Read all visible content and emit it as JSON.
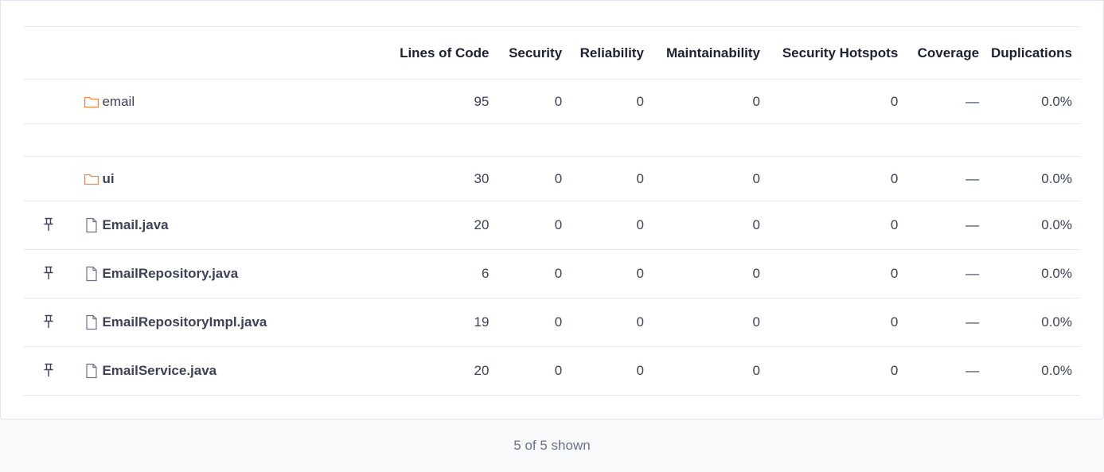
{
  "columns": {
    "loc": "Lines of Code",
    "security": "Security",
    "reliability": "Reliability",
    "maintainability": "Maintainability",
    "hotspots": "Security Hotspots",
    "coverage": "Coverage",
    "duplications": "Duplications"
  },
  "rows": [
    {
      "kind": "folder",
      "name": "email",
      "loc": "95",
      "security": "0",
      "reliability": "0",
      "maintainability": "0",
      "hotspots": "0",
      "coverage": "—",
      "duplications": "0.0%"
    },
    {
      "kind": "folder",
      "name": "ui",
      "loc": "30",
      "security": "0",
      "reliability": "0",
      "maintainability": "0",
      "hotspots": "0",
      "coverage": "—",
      "duplications": "0.0%"
    },
    {
      "kind": "file",
      "name": "Email.java",
      "loc": "20",
      "security": "0",
      "reliability": "0",
      "maintainability": "0",
      "hotspots": "0",
      "coverage": "—",
      "duplications": "0.0%"
    },
    {
      "kind": "file",
      "name": "EmailRepository.java",
      "loc": "6",
      "security": "0",
      "reliability": "0",
      "maintainability": "0",
      "hotspots": "0",
      "coverage": "—",
      "duplications": "0.0%"
    },
    {
      "kind": "file",
      "name": "EmailRepositoryImpl.java",
      "loc": "19",
      "security": "0",
      "reliability": "0",
      "maintainability": "0",
      "hotspots": "0",
      "coverage": "—",
      "duplications": "0.0%"
    },
    {
      "kind": "file",
      "name": "EmailService.java",
      "loc": "20",
      "security": "0",
      "reliability": "0",
      "maintainability": "0",
      "hotspots": "0",
      "coverage": "—",
      "duplications": "0.0%"
    }
  ],
  "footer": {
    "shown": "5 of 5 shown"
  },
  "icons": {
    "folder": "folder-icon",
    "file": "file-icon",
    "pin": "pin-icon"
  },
  "colors": {
    "folder": "#f0883e",
    "file_icon": "#6b7089",
    "border": "#e6e8ee"
  }
}
